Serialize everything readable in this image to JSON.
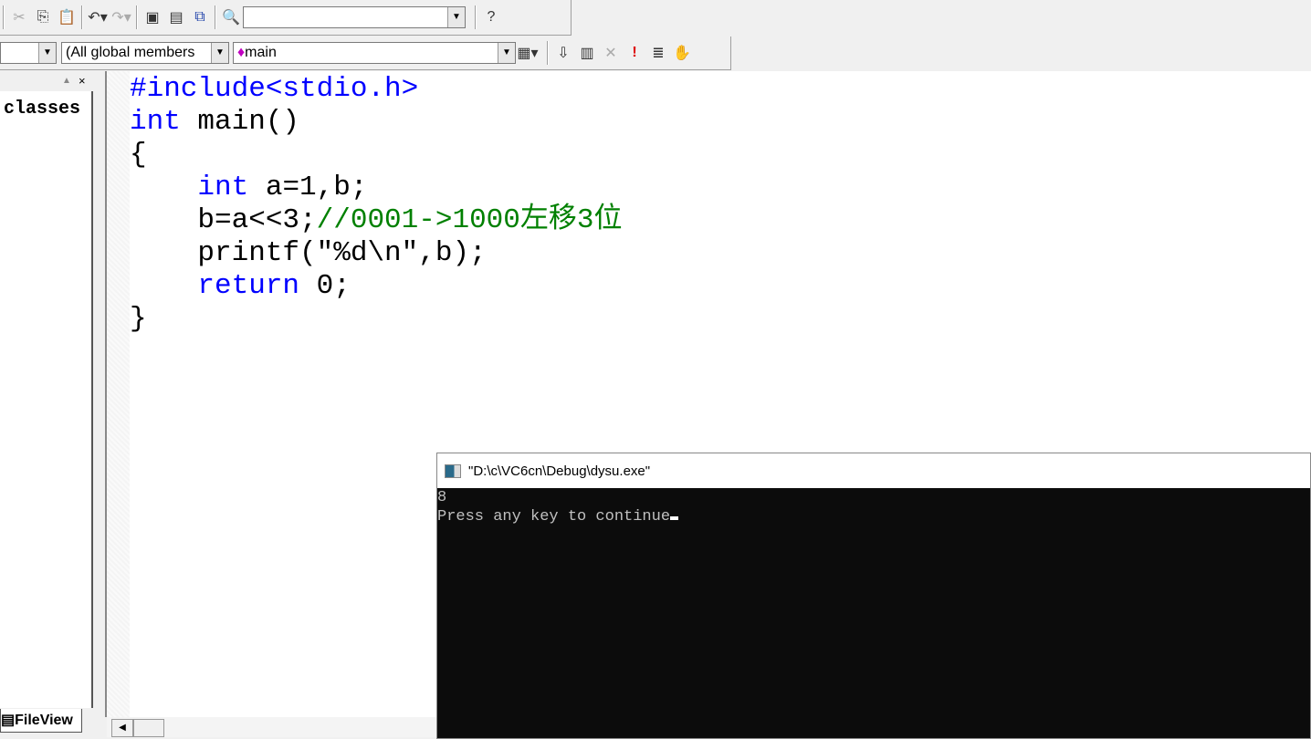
{
  "toolbar": {
    "find_value": ""
  },
  "wizardbar": {
    "class_value": "",
    "members_value": "(All global members",
    "function_value": "main"
  },
  "left_pane": {
    "header": "classes",
    "tab": "FileView"
  },
  "editor": {
    "lines": [
      [
        "#include<stdio.h>",
        "",
        ""
      ],
      [
        "int",
        " main()",
        ""
      ],
      [
        "{",
        "",
        ""
      ],
      [
        "    int",
        " a=1,b;",
        ""
      ],
      [
        "    b=a<<3;",
        "//0001->1000左移3位",
        ""
      ],
      [
        "    printf(\"%d\\n\",b);",
        "",
        ""
      ],
      [
        "    return",
        " 0;",
        ""
      ],
      [
        "}",
        "",
        ""
      ]
    ]
  },
  "console": {
    "title": "\"D:\\c\\VC6cn\\Debug\\dysu.exe\"",
    "output": [
      "8",
      "Press any key to continue"
    ]
  }
}
